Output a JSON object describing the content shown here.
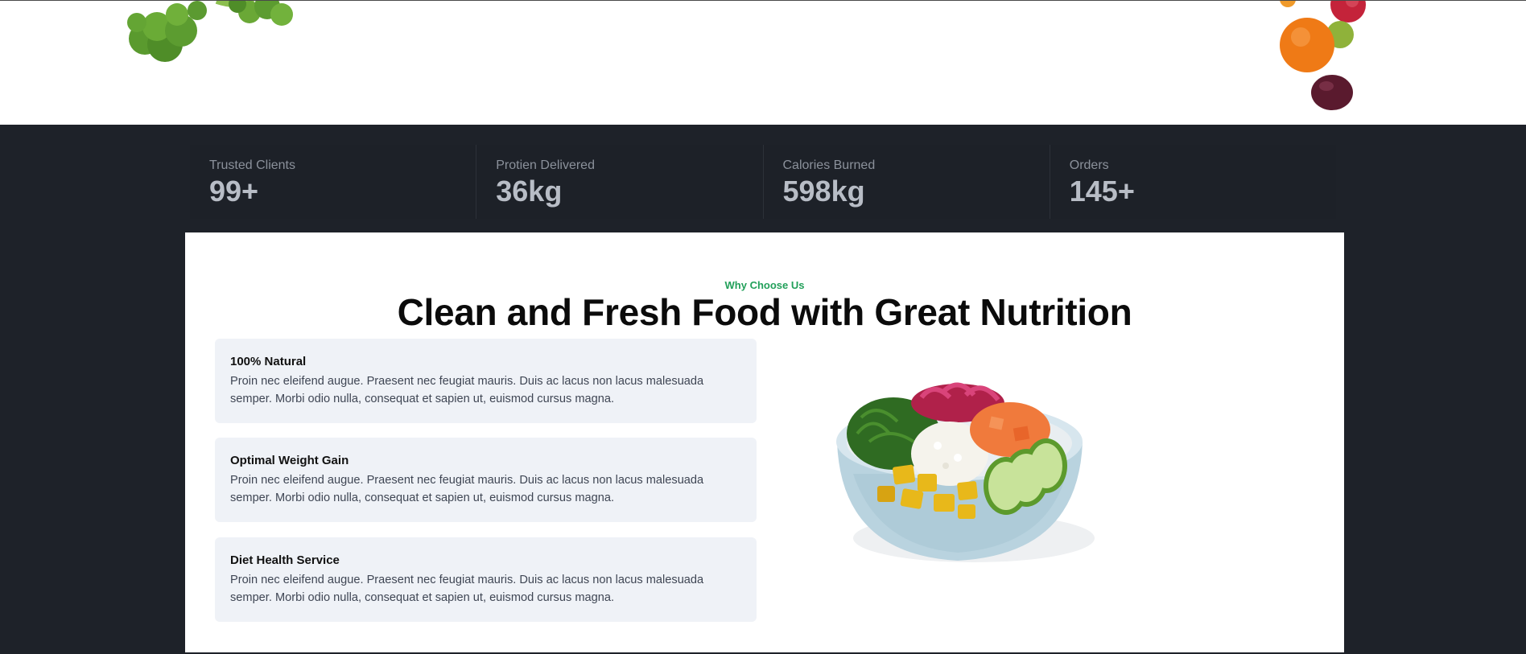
{
  "stats": [
    {
      "label": "Trusted Clients",
      "value": "99+"
    },
    {
      "label": "Protien Delivered",
      "value": "36kg"
    },
    {
      "label": "Calories Burned",
      "value": "598kg"
    },
    {
      "label": "Orders",
      "value": "145+"
    }
  ],
  "section": {
    "eyebrow": "Why Choose Us",
    "headline": "Clean and Fresh Food with Great Nutrition"
  },
  "features": [
    {
      "title": "100% Natural",
      "text": "Proin nec eleifend augue. Praesent nec feugiat mauris. Duis ac lacus non lacus malesuada semper. Morbi odio nulla, consequat et sapien ut, euismod cursus magna."
    },
    {
      "title": "Optimal Weight Gain",
      "text": "Proin nec eleifend augue. Praesent nec feugiat mauris. Duis ac lacus non lacus malesuada semper. Morbi odio nulla, consequat et sapien ut, euismod cursus magna."
    },
    {
      "title": "Diet Health Service",
      "text": "Proin nec eleifend augue. Praesent nec feugiat mauris. Duis ac lacus non lacus malesuada semper. Morbi odio nulla, consequat et sapien ut, euismod cursus magna."
    }
  ],
  "images": {
    "top_left": "broccoli-image",
    "top_right": "fruits-image",
    "feature": "poke-bowl-image"
  },
  "colors": {
    "dark_band": "#1e2229",
    "accent_green": "#22a05a",
    "feature_card": "#eff2f7"
  }
}
